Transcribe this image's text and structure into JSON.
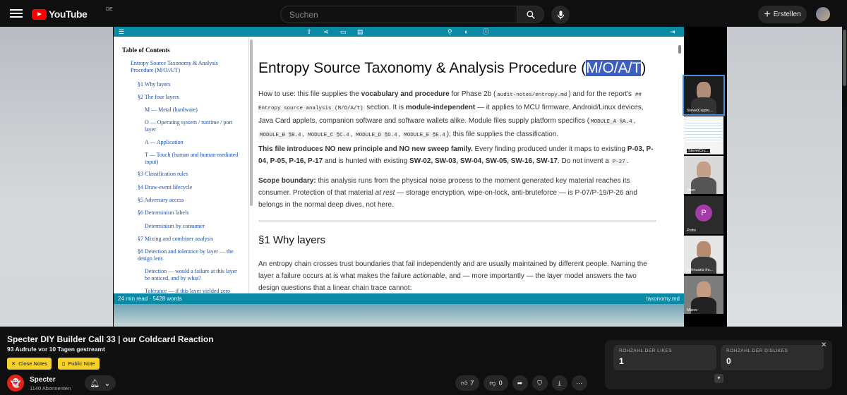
{
  "header": {
    "logo_text": "YouTube",
    "country_code": "DE",
    "search_placeholder": "Suchen",
    "create_label": "Erstellen"
  },
  "document": {
    "toc_title": "Table of Contents",
    "toc_items": [
      "Entropy Source Taxonomy & Analysis Procedure (M/O/A/T)",
      "§1 Why layers",
      "§2 The four layers",
      "M — Metal (hardware)",
      "O — Operating system / runtime / port layer",
      "A — Application",
      "T — Touch (human and human-mediated input)",
      "§3 Classification rules",
      "§4 Draw-event lifecycle",
      "§5 Adversary access",
      "§6 Determinism labels",
      "Determinism by consumer",
      "§7 Mixing and combiner analysis",
      "§8 Detection and tolerance by layer — the design lens",
      "Detection — would a failure at this layer be noticed, and by what?",
      "Tolerance — if this layer yielded zero"
    ],
    "h1_main": "Entropy Source Taxonomy & Analysis Procedure (",
    "h1_highlight": "M/O/A/T",
    "h1_end": ")",
    "p1": {
      "a": "How to use: this file supplies the ",
      "b": "vocabulary and procedure",
      "c": " for Phase 2b (",
      "code1": "audit-notes/entropy.md",
      "d": ") and for the report's ",
      "code2": "## Entropy source analysis (M/O/A/T)",
      "e": " section. It is ",
      "f": "module-independent",
      "g": " — it applies to MCU firmware, Android/Linux devices, Java Card applets, companion software and software wallets alike. Module files supply platform specifics (",
      "code3": "MODULE_A §A.4",
      "sep": ", ",
      "code4": "MODULE_B §B.4",
      "code5": "MODULE_C §C.4",
      "code6": "MODULE_D §D.4",
      "code7": "MODULE_E §E.4",
      "h": "); this file supplies the classification."
    },
    "p2": {
      "a": "This file introduces NO new principle and NO new sweep family.",
      "b": " Every finding produced under it maps to existing ",
      "c": "P-03, P-04, P-05, P-16, P-17",
      "d": " and is hunted with existing ",
      "e": "SW-02, SW-03, SW-04, SW-05, SW-16, SW-17",
      "f": ". Do not invent a ",
      "code": "P-27",
      "g": "."
    },
    "p3": {
      "a": "Scope boundary:",
      "b": " this analysis runs from the physical noise process to the moment generated key material reaches its consumer. Protection of that material ",
      "c": "at rest",
      "d": " — storage encryption, wipe-on-lock, anti-bruteforce — is P-07/P-19/P-26 and belongs in the normal deep dives, not here."
    },
    "h2": "§1 Why layers",
    "p4": {
      "a": "An entropy chain crosses trust boundaries that fail independently and are usually maintained by different people. Naming the layer a failure occurs at is what makes the failure ",
      "b": "actionable",
      "c": ", and — more importantly — the layer model answers the two design questions that a linear chain trace cannot:"
    },
    "status_left": "24 min read · 5428 words",
    "status_right": "taxonomy.md"
  },
  "participants": [
    {
      "label": "Steve(Crypto...",
      "active": true
    },
    {
      "label": "Steve(Cry...",
      "active": false
    },
    {
      "label": "Oren",
      "active": false
    },
    {
      "label": "Potto",
      "letter": "P",
      "active": false
    },
    {
      "label": "Schnuartz fro...",
      "active": false
    },
    {
      "label": "Marco",
      "active": false
    }
  ],
  "video": {
    "title": "Specter DIY Builder Call 33 | our Coldcard Reaction",
    "views": "93 Aufrufe  vor 10 Tagen gestreamt",
    "close_notes": "Close Notes",
    "public_note": "Public Note"
  },
  "channel": {
    "name": "Specter",
    "subs": "1140 Abonnenten"
  },
  "actions": {
    "likes": "7",
    "dislikes": "0"
  },
  "stats": {
    "likes_label": "ROHZAHL DER LIKES",
    "likes_value": "1",
    "dislikes_label": "ROHZAHL DER DISLIKES",
    "dislikes_value": "0"
  },
  "colors": {
    "accent_red": "#ff0000",
    "doc_teal": "#0b8aa6",
    "chip_yellow": "#f5d22b",
    "highlight": "#3d5fc4"
  }
}
